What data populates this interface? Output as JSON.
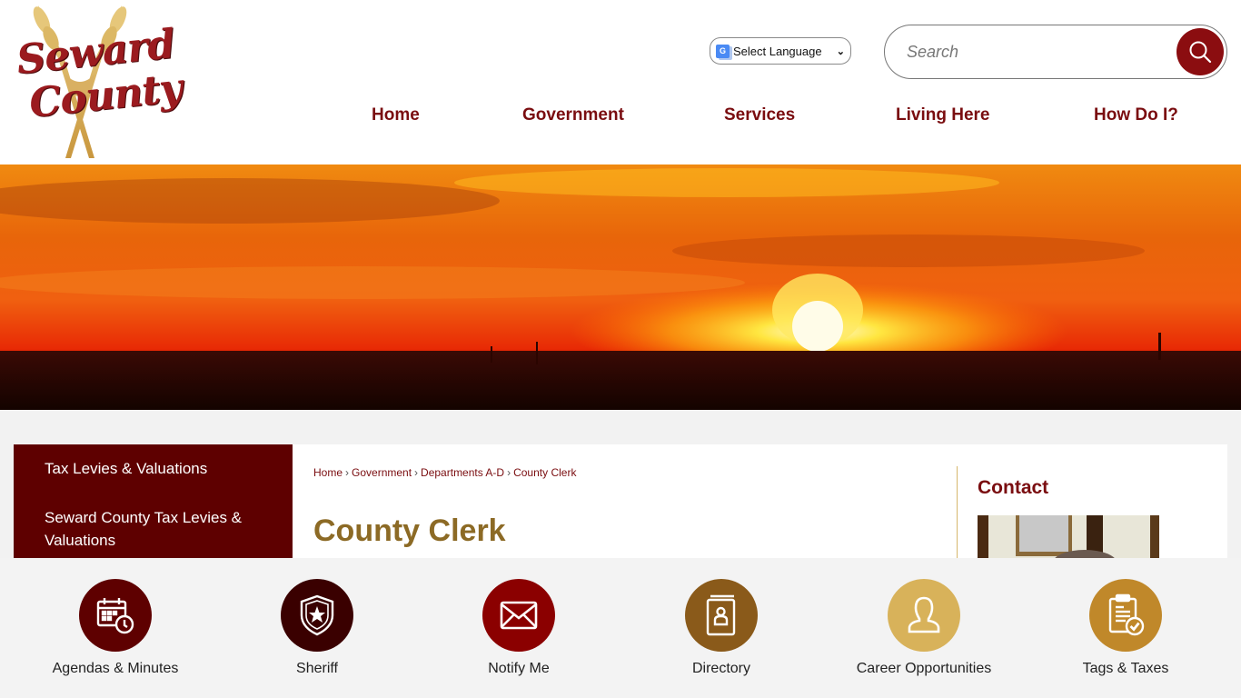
{
  "site": {
    "logo": {
      "line1": "Seward",
      "line2": "County"
    }
  },
  "header": {
    "language_select": {
      "selected": "Select Language",
      "icon": "google-translate-icon"
    },
    "search": {
      "placeholder": "Search",
      "value": "",
      "button_icon": "search-icon"
    }
  },
  "nav": {
    "items": [
      {
        "label": "Home"
      },
      {
        "label": "Government"
      },
      {
        "label": "Services"
      },
      {
        "label": "Living Here"
      },
      {
        "label": "How Do I?"
      }
    ]
  },
  "banner": {
    "description": "sunset-over-prairie"
  },
  "sidebar": {
    "items": [
      {
        "label": "Tax Levies & Valuations"
      },
      {
        "label": "Seward County Tax Levies & Valuations"
      }
    ]
  },
  "breadcrumb": {
    "items": [
      {
        "label": "Home"
      },
      {
        "label": "Government"
      },
      {
        "label": "Departments A-D"
      },
      {
        "label": "County Clerk"
      }
    ],
    "separator": "›"
  },
  "page": {
    "title": "County Clerk"
  },
  "contact": {
    "title": "Contact"
  },
  "quick_links": [
    {
      "label": "Agendas & Minutes",
      "icon": "calendar-clock-icon",
      "color": "#5e0000"
    },
    {
      "label": "Sheriff",
      "icon": "shield-star-icon",
      "color": "#3a0000"
    },
    {
      "label": "Notify Me",
      "icon": "envelope-icon",
      "color": "#8b0000"
    },
    {
      "label": "Directory",
      "icon": "contact-book-icon",
      "color": "#8a5a1a"
    },
    {
      "label": "Career Opportunities",
      "icon": "person-icon",
      "color": "#d8b25a"
    },
    {
      "label": "Tags & Taxes",
      "icon": "clipboard-check-icon",
      "color": "#c0882a"
    }
  ],
  "colors": {
    "brand_red": "#7a0d10",
    "sidebar_bg": "#5e0000",
    "title_gold": "#8c6a25",
    "search_button": "#8b0d10"
  }
}
